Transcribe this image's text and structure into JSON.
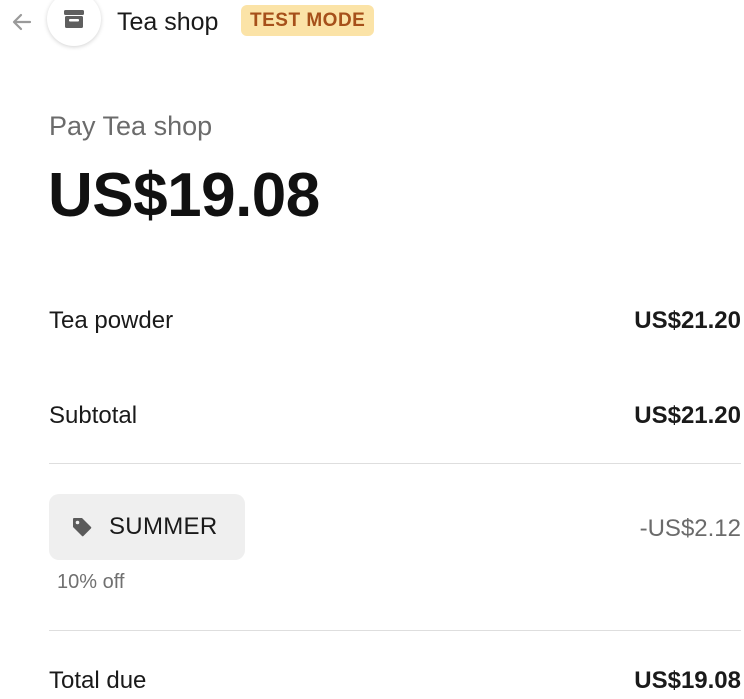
{
  "header": {
    "shop_name": "Tea shop",
    "test_mode_label": "TEST MODE",
    "back_icon": "arrow-left-icon",
    "store_icon": "store-icon"
  },
  "summary": {
    "pay_label": "Pay Tea shop",
    "amount": "US$19.08"
  },
  "line_items": [
    {
      "name": "Tea powder",
      "amount": "US$21.20"
    }
  ],
  "subtotal": {
    "label": "Subtotal",
    "amount": "US$21.20"
  },
  "promotion": {
    "code": "SUMMER",
    "description": "10% off",
    "discount": "-US$2.12",
    "icon": "tag-icon"
  },
  "total": {
    "label": "Total due",
    "amount": "US$19.08"
  },
  "colors": {
    "test_mode_bg": "#fbe3a7",
    "test_mode_text": "#a6501a",
    "chip_bg": "#efefef",
    "divider": "#dedede"
  }
}
